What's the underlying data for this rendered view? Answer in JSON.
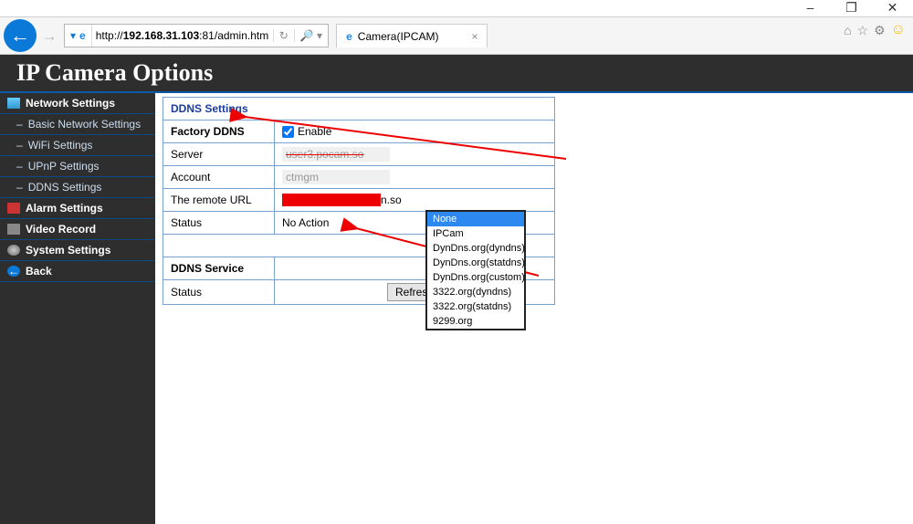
{
  "window": {
    "minimize": "–",
    "maximize": "❐",
    "close": "✕"
  },
  "browser": {
    "url_prefix": "http://",
    "url_host": "192.168.31.103",
    "url_rest": ":81/admin.htm",
    "tab_title": "Camera(IPCAM)"
  },
  "header": {
    "title": "IP Camera Options"
  },
  "sidebar": {
    "groups": [
      {
        "label": "Network Settings"
      },
      {
        "label": "Alarm Settings"
      },
      {
        "label": "Video Record"
      },
      {
        "label": "System Settings"
      },
      {
        "label": "Back"
      }
    ],
    "network_sub": [
      "Basic Network Settings",
      "WiFi Settings",
      "UPnP Settings",
      "DDNS Settings"
    ]
  },
  "ddns": {
    "title": "DDNS Settings",
    "rows": {
      "factory": "Factory DDNS",
      "enable": "Enable",
      "server": "Server",
      "server_val": "user3.pocam.so",
      "account": "Account",
      "account_val": "ctmgm",
      "remote": "The remote URL",
      "remote_suffix": "n.so",
      "status": "Status",
      "status_val": "No Action"
    },
    "service_title": "DDNS Service",
    "service_status": "Status",
    "refresh": "Refresh",
    "options": [
      "None",
      "IPCam",
      "DynDns.org(dyndns)",
      "DynDns.org(statdns)",
      "DynDns.org(custom)",
      "3322.org(dyndns)",
      "3322.org(statdns)",
      "9299.org"
    ]
  }
}
